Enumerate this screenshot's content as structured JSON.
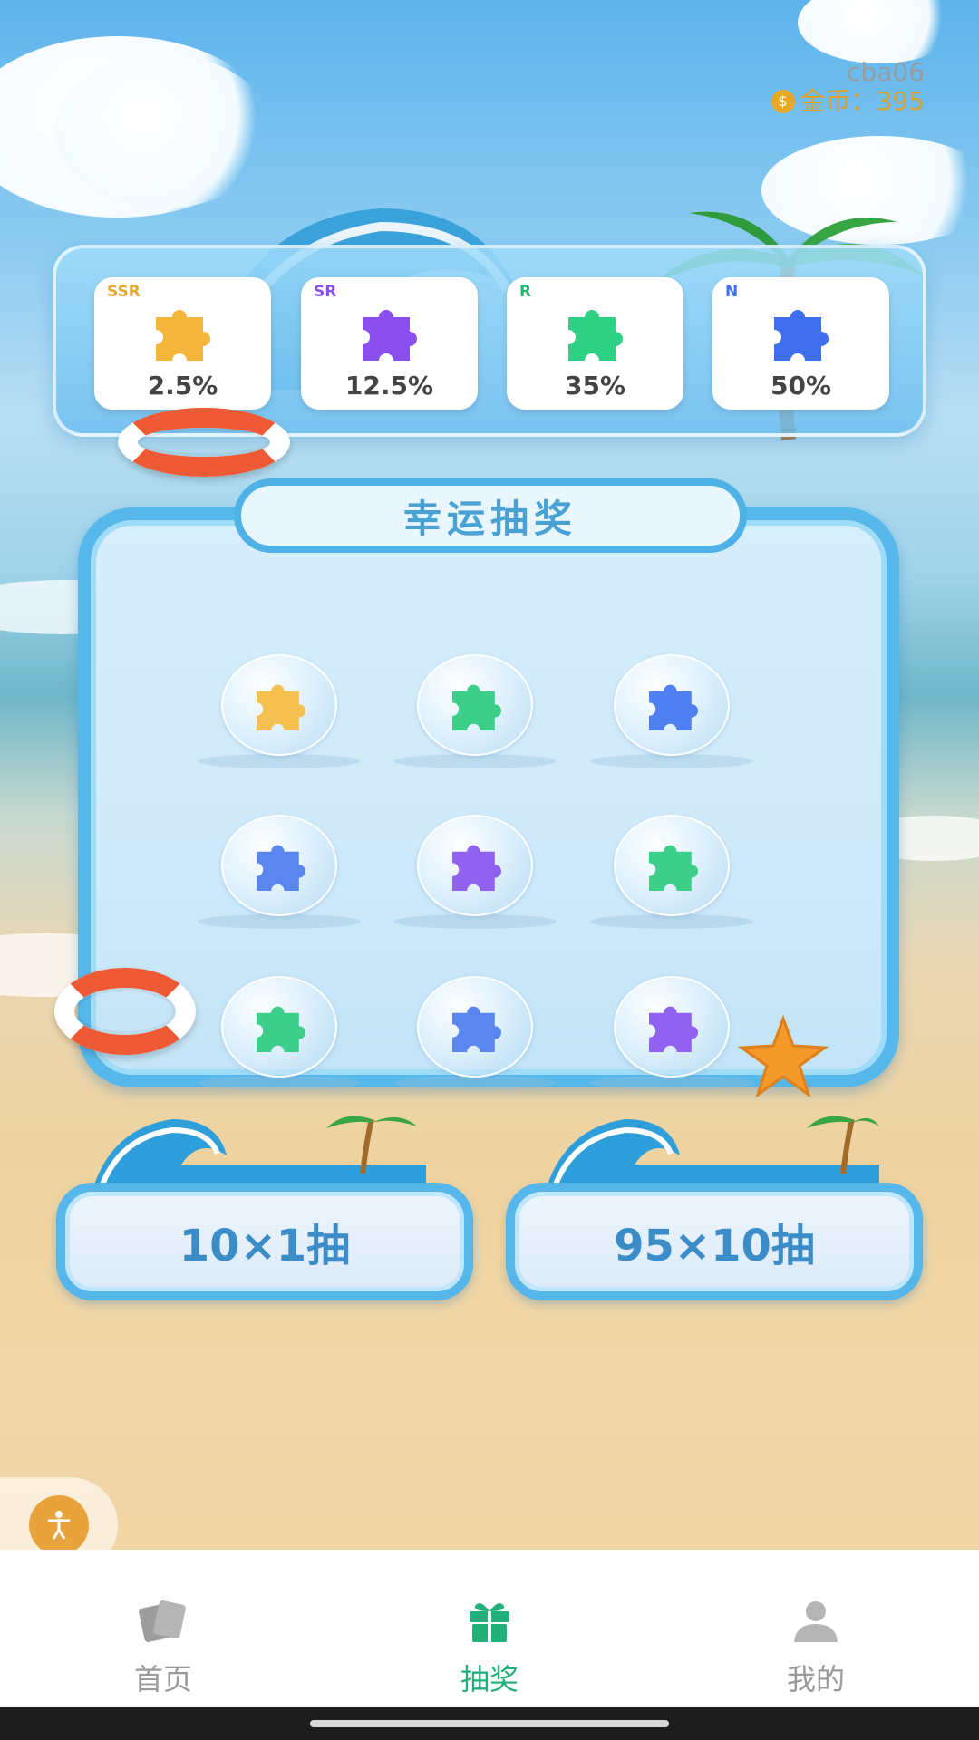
{
  "user": {
    "name": "cba06",
    "coins_label": "金币：395"
  },
  "rates": [
    {
      "tier": "SSR",
      "value": "2.5%",
      "color": "#f4b63a"
    },
    {
      "tier": "SR",
      "value": "12.5%",
      "color": "#8b4ff0"
    },
    {
      "tier": "R",
      "value": "35%",
      "color": "#2ed184"
    },
    {
      "tier": "N",
      "value": "50%",
      "color": "#3f6fef"
    }
  ],
  "lottery": {
    "title": "幸运抽奖",
    "grid_colors": [
      "#f4c04f",
      "#3dcf8a",
      "#4f7ff0",
      "#5b86f0",
      "#9162f0",
      "#3dcf8a",
      "#3dcf8a",
      "#5b86f0",
      "#9162f0"
    ]
  },
  "buttons": {
    "single": "10×1抽",
    "ten": "95×10抽"
  },
  "tabs": {
    "home": "首页",
    "draw": "抽奖",
    "mine": "我的",
    "active_color": "#22b07a"
  }
}
